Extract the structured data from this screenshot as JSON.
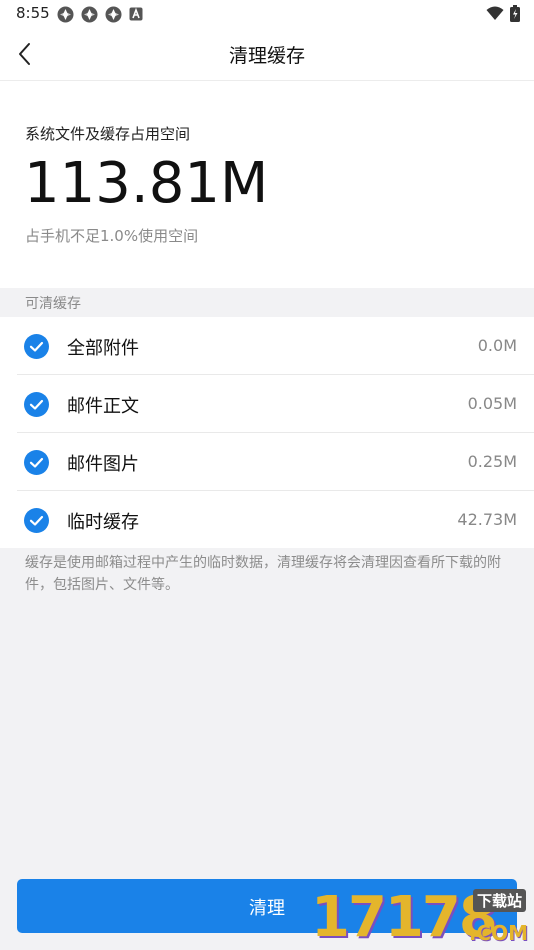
{
  "status_bar": {
    "time": "8:55"
  },
  "nav": {
    "title": "清理缓存"
  },
  "summary": {
    "label": "系统文件及缓存占用空间",
    "size": "113.81M",
    "note": "占手机不足1.0%使用空间"
  },
  "section": {
    "header": "可清缓存"
  },
  "items": [
    {
      "label": "全部附件",
      "size": "0.0M",
      "checked": true
    },
    {
      "label": "邮件正文",
      "size": "0.05M",
      "checked": true
    },
    {
      "label": "邮件图片",
      "size": "0.25M",
      "checked": true
    },
    {
      "label": "临时缓存",
      "size": "42.73M",
      "checked": true
    }
  ],
  "footnote": "缓存是使用邮箱过程中产生的临时数据，清理缓存将会清理因查看所下载的附件，包括图片、文件等。",
  "button": {
    "label": "清理"
  },
  "watermark": {
    "digits": "17178",
    "site": "下载站",
    "domain": ".COM"
  },
  "colors": {
    "accent": "#1a82e8",
    "secondary_text": "#8a8a8a"
  }
}
